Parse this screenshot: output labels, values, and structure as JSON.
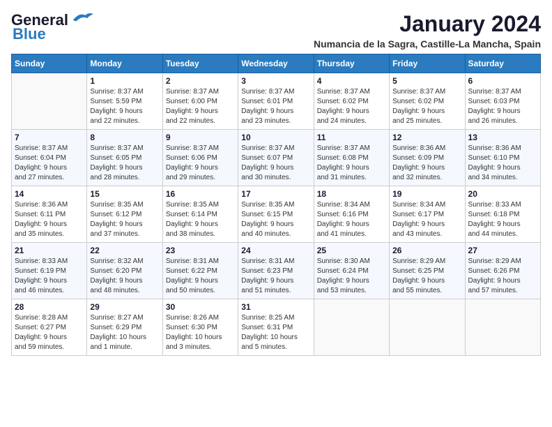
{
  "header": {
    "logo_line1": "General",
    "logo_line2": "Blue",
    "main_title": "January 2024",
    "subtitle": "Numancia de la Sagra, Castille-La Mancha, Spain"
  },
  "weekdays": [
    "Sunday",
    "Monday",
    "Tuesday",
    "Wednesday",
    "Thursday",
    "Friday",
    "Saturday"
  ],
  "weeks": [
    [
      {
        "day": "",
        "info": ""
      },
      {
        "day": "1",
        "info": "Sunrise: 8:37 AM\nSunset: 5:59 PM\nDaylight: 9 hours\nand 22 minutes."
      },
      {
        "day": "2",
        "info": "Sunrise: 8:37 AM\nSunset: 6:00 PM\nDaylight: 9 hours\nand 22 minutes."
      },
      {
        "day": "3",
        "info": "Sunrise: 8:37 AM\nSunset: 6:01 PM\nDaylight: 9 hours\nand 23 minutes."
      },
      {
        "day": "4",
        "info": "Sunrise: 8:37 AM\nSunset: 6:02 PM\nDaylight: 9 hours\nand 24 minutes."
      },
      {
        "day": "5",
        "info": "Sunrise: 8:37 AM\nSunset: 6:02 PM\nDaylight: 9 hours\nand 25 minutes."
      },
      {
        "day": "6",
        "info": "Sunrise: 8:37 AM\nSunset: 6:03 PM\nDaylight: 9 hours\nand 26 minutes."
      }
    ],
    [
      {
        "day": "7",
        "info": "Sunrise: 8:37 AM\nSunset: 6:04 PM\nDaylight: 9 hours\nand 27 minutes."
      },
      {
        "day": "8",
        "info": "Sunrise: 8:37 AM\nSunset: 6:05 PM\nDaylight: 9 hours\nand 28 minutes."
      },
      {
        "day": "9",
        "info": "Sunrise: 8:37 AM\nSunset: 6:06 PM\nDaylight: 9 hours\nand 29 minutes."
      },
      {
        "day": "10",
        "info": "Sunrise: 8:37 AM\nSunset: 6:07 PM\nDaylight: 9 hours\nand 30 minutes."
      },
      {
        "day": "11",
        "info": "Sunrise: 8:37 AM\nSunset: 6:08 PM\nDaylight: 9 hours\nand 31 minutes."
      },
      {
        "day": "12",
        "info": "Sunrise: 8:36 AM\nSunset: 6:09 PM\nDaylight: 9 hours\nand 32 minutes."
      },
      {
        "day": "13",
        "info": "Sunrise: 8:36 AM\nSunset: 6:10 PM\nDaylight: 9 hours\nand 34 minutes."
      }
    ],
    [
      {
        "day": "14",
        "info": "Sunrise: 8:36 AM\nSunset: 6:11 PM\nDaylight: 9 hours\nand 35 minutes."
      },
      {
        "day": "15",
        "info": "Sunrise: 8:35 AM\nSunset: 6:12 PM\nDaylight: 9 hours\nand 37 minutes."
      },
      {
        "day": "16",
        "info": "Sunrise: 8:35 AM\nSunset: 6:14 PM\nDaylight: 9 hours\nand 38 minutes."
      },
      {
        "day": "17",
        "info": "Sunrise: 8:35 AM\nSunset: 6:15 PM\nDaylight: 9 hours\nand 40 minutes."
      },
      {
        "day": "18",
        "info": "Sunrise: 8:34 AM\nSunset: 6:16 PM\nDaylight: 9 hours\nand 41 minutes."
      },
      {
        "day": "19",
        "info": "Sunrise: 8:34 AM\nSunset: 6:17 PM\nDaylight: 9 hours\nand 43 minutes."
      },
      {
        "day": "20",
        "info": "Sunrise: 8:33 AM\nSunset: 6:18 PM\nDaylight: 9 hours\nand 44 minutes."
      }
    ],
    [
      {
        "day": "21",
        "info": "Sunrise: 8:33 AM\nSunset: 6:19 PM\nDaylight: 9 hours\nand 46 minutes."
      },
      {
        "day": "22",
        "info": "Sunrise: 8:32 AM\nSunset: 6:20 PM\nDaylight: 9 hours\nand 48 minutes."
      },
      {
        "day": "23",
        "info": "Sunrise: 8:31 AM\nSunset: 6:22 PM\nDaylight: 9 hours\nand 50 minutes."
      },
      {
        "day": "24",
        "info": "Sunrise: 8:31 AM\nSunset: 6:23 PM\nDaylight: 9 hours\nand 51 minutes."
      },
      {
        "day": "25",
        "info": "Sunrise: 8:30 AM\nSunset: 6:24 PM\nDaylight: 9 hours\nand 53 minutes."
      },
      {
        "day": "26",
        "info": "Sunrise: 8:29 AM\nSunset: 6:25 PM\nDaylight: 9 hours\nand 55 minutes."
      },
      {
        "day": "27",
        "info": "Sunrise: 8:29 AM\nSunset: 6:26 PM\nDaylight: 9 hours\nand 57 minutes."
      }
    ],
    [
      {
        "day": "28",
        "info": "Sunrise: 8:28 AM\nSunset: 6:27 PM\nDaylight: 9 hours\nand 59 minutes."
      },
      {
        "day": "29",
        "info": "Sunrise: 8:27 AM\nSunset: 6:29 PM\nDaylight: 10 hours\nand 1 minute."
      },
      {
        "day": "30",
        "info": "Sunrise: 8:26 AM\nSunset: 6:30 PM\nDaylight: 10 hours\nand 3 minutes."
      },
      {
        "day": "31",
        "info": "Sunrise: 8:25 AM\nSunset: 6:31 PM\nDaylight: 10 hours\nand 5 minutes."
      },
      {
        "day": "",
        "info": ""
      },
      {
        "day": "",
        "info": ""
      },
      {
        "day": "",
        "info": ""
      }
    ]
  ]
}
